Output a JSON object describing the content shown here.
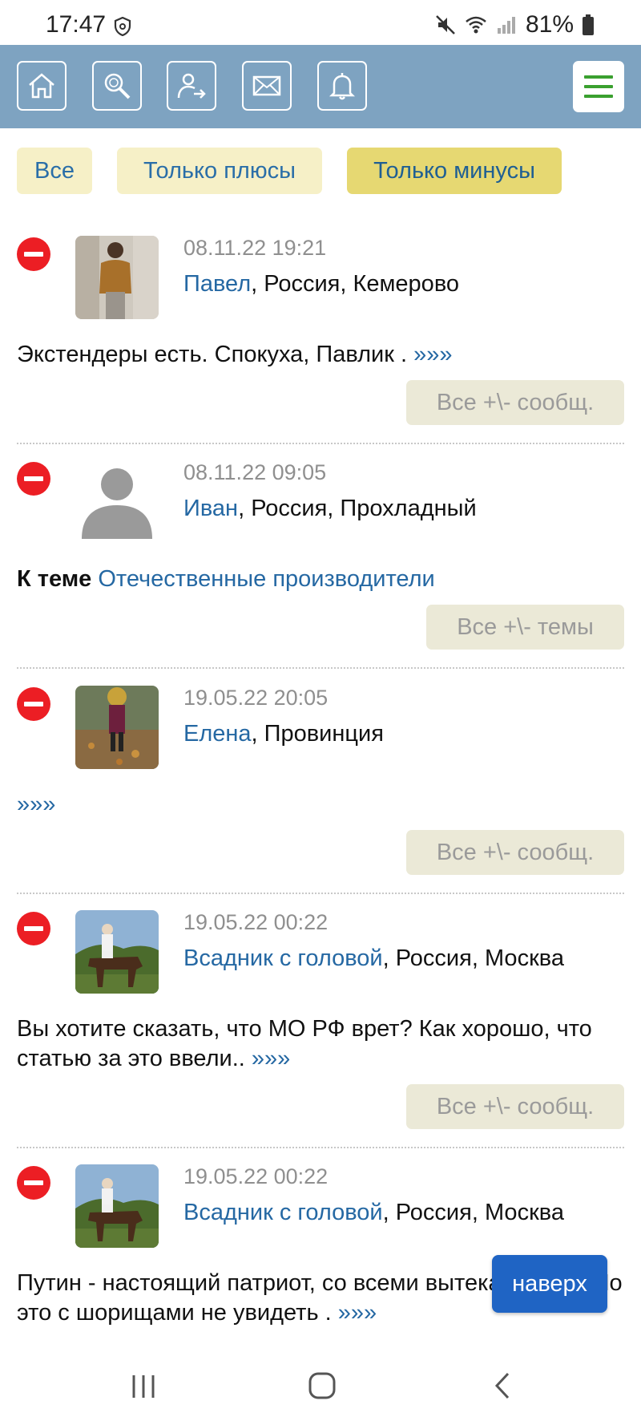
{
  "status_bar": {
    "time": "17:47",
    "battery": "81%"
  },
  "nav": {
    "icons": [
      "home-icon",
      "search-icon",
      "login-icon",
      "mail-icon",
      "bell-icon",
      "menu-icon"
    ],
    "menu_color": "#3aa02f",
    "bar_color": "#7ea3c1"
  },
  "filters": [
    {
      "label": "Все",
      "active": false
    },
    {
      "label": "Только плюсы",
      "active": false
    },
    {
      "label": "Только минусы",
      "active": true
    }
  ],
  "entries": [
    {
      "date": "08.11.22 19:21",
      "name": "Павел",
      "location": ", Россия, Кемерово",
      "text": "Экстендеры есть. Спокуха, Павлик . ",
      "more": "»»»",
      "button": "Все +\\- сообщ."
    },
    {
      "date": "08.11.22 09:05",
      "name": "Иван",
      "location": ", Россия, Прохладный",
      "topic_prefix": "К теме",
      "topic": "Отечественные производители",
      "button": "Все +\\- темы"
    },
    {
      "date": "19.05.22 20:05",
      "name": "Елена",
      "location": ", Провинция",
      "more": "»»»",
      "button": "Все +\\- сообщ."
    },
    {
      "date": "19.05.22 00:22",
      "name": "Всадник с головой",
      "location": ", Россия, Москва",
      "text": "Вы хотите сказать, что МО РФ врет? Как хорошо, что статью за это ввели.. ",
      "more": "»»»",
      "button": "Все +\\- сообщ."
    },
    {
      "date": "19.05.22 00:22",
      "name": "Всадник с головой",
      "location": ", Россия, Москва",
      "text": "Путин - настоящий патриот, со всеми вытекающими. Но это с шорищами не увидеть . ",
      "more": "»»»"
    }
  ],
  "up_button": "наверх"
}
